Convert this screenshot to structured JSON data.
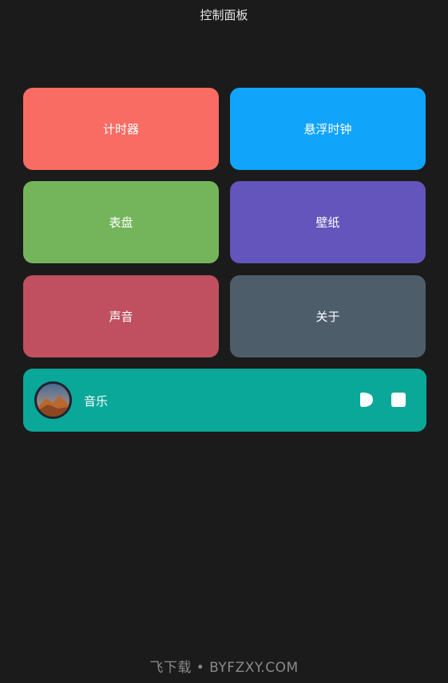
{
  "header": {
    "title": "控制面板"
  },
  "tiles": [
    {
      "label": "计时器",
      "color": "#f96c64"
    },
    {
      "label": "悬浮时钟",
      "color": "#10a4fb"
    },
    {
      "label": "表盘",
      "color": "#74b55c"
    },
    {
      "label": "壁纸",
      "color": "#6355bb"
    },
    {
      "label": "声音",
      "color": "#c0505f"
    },
    {
      "label": "关于",
      "color": "#4e5d6a"
    }
  ],
  "music": {
    "label": "音乐",
    "color": "#0aa898",
    "cover_icon": "album-cover-icon",
    "play_icon": "play-icon",
    "stop_icon": "stop-icon"
  },
  "footer": {
    "watermark": "飞下载 • BYFZXY.COM"
  }
}
